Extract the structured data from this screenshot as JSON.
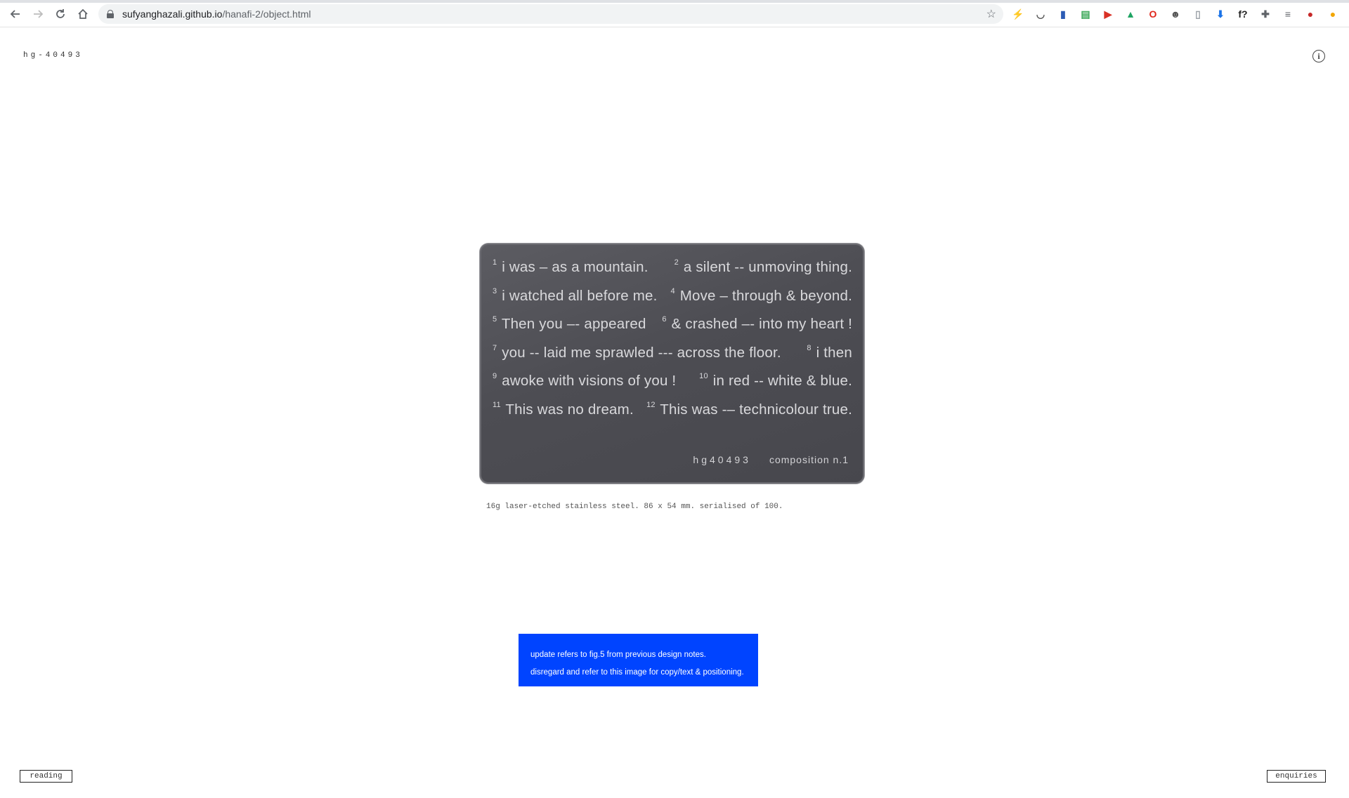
{
  "browser": {
    "url_host": "sufyanghazali.github.io",
    "url_path": "/hanafi-2/object.html",
    "extensions": [
      {
        "icon": "bolt-icon",
        "glyph": "⚡",
        "color": "#333333"
      },
      {
        "icon": "pocket-icon",
        "glyph": "◡",
        "color": "#555555"
      },
      {
        "icon": "book-icon",
        "glyph": "▮",
        "color": "#2b5bb5"
      },
      {
        "icon": "printer-icon",
        "glyph": "▤",
        "color": "#3aa757"
      },
      {
        "icon": "video-icon",
        "glyph": "▶",
        "color": "#d93025"
      },
      {
        "icon": "drive-icon",
        "glyph": "▲",
        "color": "#1fa463"
      },
      {
        "icon": "opera-icon",
        "glyph": "O",
        "color": "#e0261b"
      },
      {
        "icon": "skull-icon",
        "glyph": "☻",
        "color": "#555555"
      },
      {
        "icon": "page-icon",
        "glyph": "▯",
        "color": "#9aa0a6"
      },
      {
        "icon": "download-icon",
        "glyph": "⬇",
        "color": "#1a73e8"
      },
      {
        "icon": "fontface-icon",
        "glyph": "f?",
        "color": "#222222"
      },
      {
        "icon": "puzzle-icon",
        "glyph": "✚",
        "color": "#5f6368"
      },
      {
        "icon": "reading-list-icon",
        "glyph": "≡",
        "color": "#5f6368"
      },
      {
        "icon": "profile-avatar-icon",
        "glyph": "●",
        "color": "#c62828"
      },
      {
        "icon": "update-dot-icon",
        "glyph": "●",
        "color": "#f2a600"
      }
    ]
  },
  "page": {
    "serial_tag": "hg-40493",
    "plate": {
      "lines": [
        [
          {
            "n": "1",
            "t": "i was – as a mountain."
          },
          {
            "n": "2",
            "t": "a silent -- unmoving thing."
          }
        ],
        [
          {
            "n": "3",
            "t": "i watched all before me."
          },
          {
            "n": "4",
            "t": "Move – through & beyond."
          }
        ],
        [
          {
            "n": "5",
            "t": "Then you –- appeared"
          },
          {
            "n": "6",
            "t": "& crashed –- into my heart !"
          }
        ],
        [
          {
            "n": "7",
            "t": "you -- laid me sprawled --- across the floor."
          },
          {
            "n": "8",
            "t": "i then"
          }
        ],
        [
          {
            "n": "9",
            "t": "awoke with visions of you !"
          },
          {
            "n": "10",
            "t": "in red -- white & blue."
          }
        ],
        [
          {
            "n": "11",
            "t": "This was no dream."
          },
          {
            "n": "12",
            "t": "This was -– technicolour true."
          }
        ]
      ],
      "serial": "hg40493",
      "composition": "composition n.1"
    },
    "caption": "16g laser-etched stainless steel. 86 x 54 mm. serialised of 100.",
    "note": {
      "line1": "update refers to fig.5 from previous design notes.",
      "line2": "disregard and refer to this image for copy/text & positioning."
    },
    "buttons": {
      "reading": "reading",
      "enquiries": "enquiries",
      "info": "i"
    }
  }
}
